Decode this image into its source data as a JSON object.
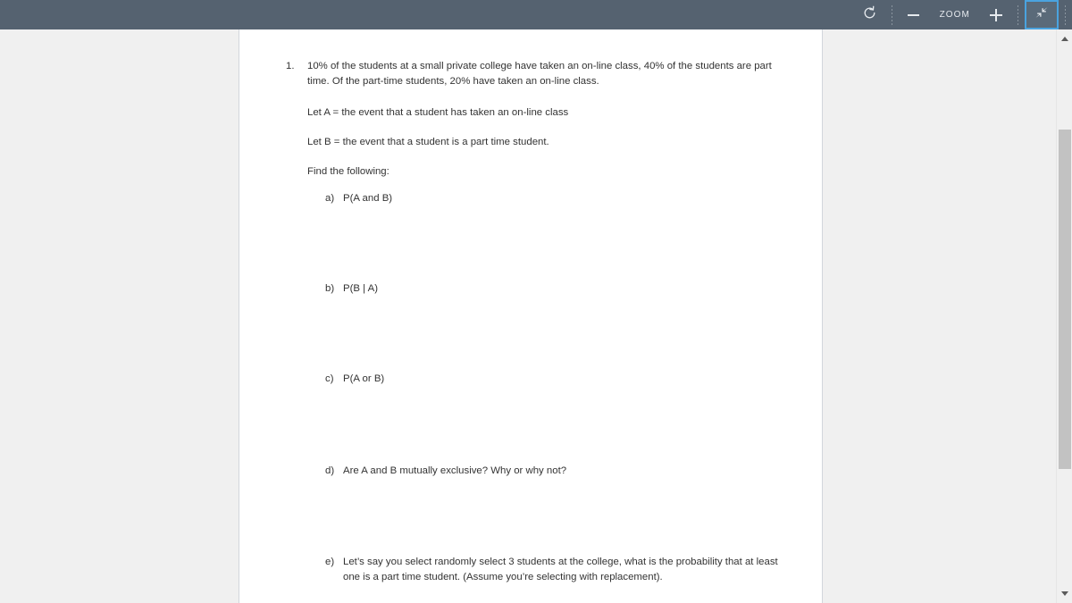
{
  "toolbar": {
    "rotate_icon": "rotate-ccw-icon",
    "zoom_out_icon": "minus-icon",
    "zoom_label": "ZOOM",
    "zoom_in_icon": "plus-icon",
    "fullscreen_exit_icon": "fullscreen-exit-icon",
    "accent_color": "#4aa3df",
    "background_color": "#556270"
  },
  "document": {
    "problem_number": "1.",
    "statement": "10% of the students at a small private college have taken an on-line class, 40% of the students are part time.  Of the part-time students, 20% have taken an on-line class.",
    "definition_a": "Let A = the event that a student has taken an on-line class",
    "definition_b": "Let B = the event that a student is a part time student.",
    "find_prompt": "Find the following:",
    "subitems": [
      {
        "label": "a)",
        "text": "P(A and B)"
      },
      {
        "label": "b)",
        "text": "P(B | A)"
      },
      {
        "label": "c)",
        "text": "P(A or B)"
      },
      {
        "label": "d)",
        "text": "Are A and B mutually exclusive?  Why or why not?"
      },
      {
        "label": "e)",
        "text": "Let’s say you select randomly select 3 students at the college, what is the probability that at least one is a part time student.  (Assume you’re selecting with replacement)."
      }
    ]
  },
  "scrollbar": {
    "up_arrow_icon": "caret-up-icon",
    "down_arrow_icon": "caret-down-icon",
    "thumb_name": "scrollbar-thumb"
  }
}
